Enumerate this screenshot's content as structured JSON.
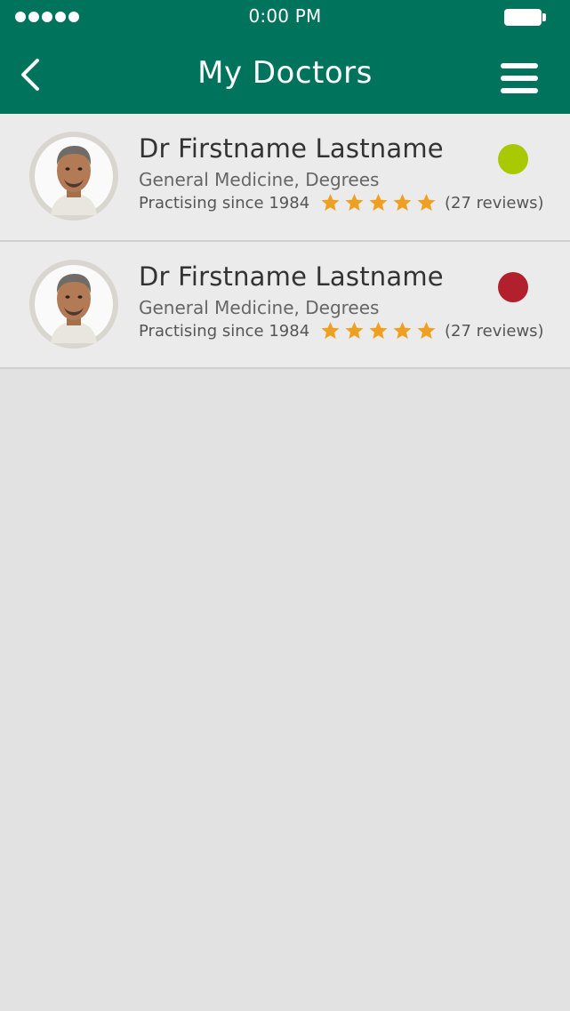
{
  "status_bar": {
    "time": "0:00 PM",
    "signal_icon": "signal-dots-icon",
    "battery_icon": "battery-icon"
  },
  "navbar": {
    "title": "My Doctors",
    "back_icon": "chevron-left-icon",
    "menu_icon": "hamburger-menu-icon"
  },
  "colors": {
    "header": "#00735d",
    "star": "#f0a020",
    "online": "#a8c800",
    "offline": "#b1202c"
  },
  "doctors": [
    {
      "name": "Dr Firstname Lastname",
      "specialty": "General Medicine, Degrees",
      "practising": "Practising since 1984",
      "rating": 5,
      "reviews": "(27 reviews)",
      "status": "online",
      "status_color": "#a8c800"
    },
    {
      "name": "Dr Firstname Lastname",
      "specialty": "General Medicine, Degrees",
      "practising": "Practising since 1984",
      "rating": 5,
      "reviews": "(27 reviews)",
      "status": "offline",
      "status_color": "#b1202c"
    }
  ]
}
